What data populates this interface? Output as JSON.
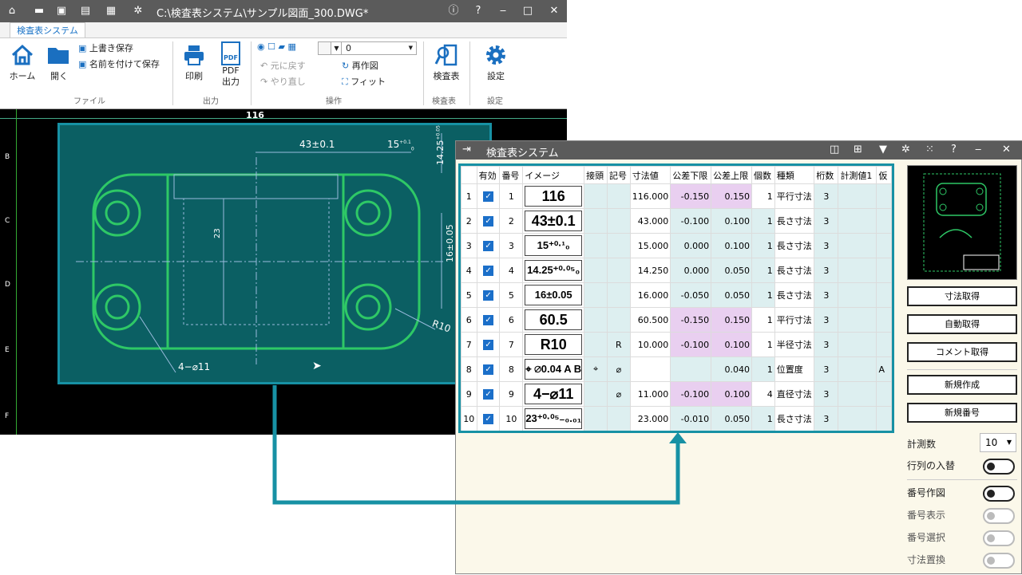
{
  "app": {
    "title": "C:\\検査表システム\\サンプル図面_300.DWG*",
    "tab": "検査表システム",
    "ribbon": {
      "home": "ホーム",
      "open": "開く",
      "save": "上書き保存",
      "save_as": "名前を付けて保存",
      "print": "印刷",
      "pdf_icon": "PDF",
      "pdf_out": "PDF出力",
      "layer_value": "0",
      "undo": "元に戻す",
      "redo": "やり直し",
      "redraw": "再作図",
      "fit": "フィット",
      "inspect": "検査表",
      "settings": "設定",
      "groups": {
        "file": "ファイル",
        "output": "出力",
        "operate": "操作",
        "inspect": "検査表",
        "settings": "設定"
      }
    }
  },
  "drawing": {
    "dims": {
      "top": "116",
      "d43": "43±0.1",
      "d15": "15",
      "d15tol": "+0.1",
      "d15tol2": "0",
      "d14": "14.25",
      "d14tol": "+0.05",
      "d23": "23",
      "d16": "16±0.05",
      "r10": "R10",
      "hole": "4−⌀11"
    },
    "ruler": [
      "B",
      "C",
      "D",
      "E",
      "F"
    ]
  },
  "inspector": {
    "title": "検査表システム",
    "columns": [
      "有効",
      "番号",
      "イメージ",
      "接頭",
      "記号",
      "寸法値",
      "公差下限",
      "公差上限",
      "個数",
      "種類",
      "桁数",
      "計測値1",
      "仮"
    ],
    "rows": [
      {
        "idx": "1",
        "num": "1",
        "img": "116",
        "prefix": "",
        "sym": "",
        "val": "116.000",
        "low": "-0.150",
        "up": "0.150",
        "qty": "1",
        "kind": "平行寸法",
        "digits": "3",
        "m1": "",
        "ex": ""
      },
      {
        "idx": "2",
        "num": "2",
        "img": "43±0.1",
        "prefix": "",
        "sym": "",
        "val": "43.000",
        "low": "-0.100",
        "up": "0.100",
        "qty": "1",
        "kind": "長さ寸法",
        "digits": "3",
        "m1": "",
        "ex": ""
      },
      {
        "idx": "3",
        "num": "3",
        "img": "15⁺⁰·¹₀",
        "prefix": "",
        "sym": "",
        "val": "15.000",
        "low": "0.000",
        "up": "0.100",
        "qty": "1",
        "kind": "長さ寸法",
        "digits": "3",
        "m1": "",
        "ex": ""
      },
      {
        "idx": "4",
        "num": "4",
        "img": "14.25⁺⁰·⁰⁵₀",
        "prefix": "",
        "sym": "",
        "val": "14.250",
        "low": "0.000",
        "up": "0.050",
        "qty": "1",
        "kind": "長さ寸法",
        "digits": "3",
        "m1": "",
        "ex": ""
      },
      {
        "idx": "5",
        "num": "5",
        "img": "16±0.05",
        "prefix": "",
        "sym": "",
        "val": "16.000",
        "low": "-0.050",
        "up": "0.050",
        "qty": "1",
        "kind": "長さ寸法",
        "digits": "3",
        "m1": "",
        "ex": ""
      },
      {
        "idx": "6",
        "num": "6",
        "img": "60.5",
        "prefix": "",
        "sym": "",
        "val": "60.500",
        "low": "-0.150",
        "up": "0.150",
        "qty": "1",
        "kind": "平行寸法",
        "digits": "3",
        "m1": "",
        "ex": ""
      },
      {
        "idx": "7",
        "num": "7",
        "img": "R10",
        "prefix": "",
        "sym": "R",
        "val": "10.000",
        "low": "-0.100",
        "up": "0.100",
        "qty": "1",
        "kind": "半径寸法",
        "digits": "3",
        "m1": "",
        "ex": ""
      },
      {
        "idx": "8",
        "num": "8",
        "img": "⌖ ⌀0.04 A B",
        "prefix": "⌖",
        "sym": "⌀",
        "val": "",
        "low": "",
        "up": "0.040",
        "qty": "1",
        "kind": "位置度",
        "digits": "3",
        "m1": "",
        "ex": "A"
      },
      {
        "idx": "9",
        "num": "9",
        "img": "4−⌀11",
        "prefix": "",
        "sym": "⌀",
        "val": "11.000",
        "low": "-0.100",
        "up": "0.100",
        "qty": "4",
        "kind": "直径寸法",
        "digits": "3",
        "m1": "",
        "ex": ""
      },
      {
        "idx": "10",
        "num": "10",
        "img": "23⁺⁰·⁰⁵₋₀.₀₁",
        "prefix": "",
        "sym": "",
        "val": "23.000",
        "low": "-0.010",
        "up": "0.050",
        "qty": "1",
        "kind": "長さ寸法",
        "digits": "3",
        "m1": "",
        "ex": ""
      }
    ],
    "buttons": {
      "get_dim": "寸法取得",
      "auto_get": "自動取得",
      "get_comment": "コメント取得",
      "new_create": "新規作成",
      "new_number": "新規番号"
    },
    "measure_label": "計測数",
    "measure_value": "10",
    "toggles": {
      "swap": "行列の入替",
      "num_draw": "番号作図",
      "num_show": "番号表示",
      "num_select": "番号選択",
      "dim_replace": "寸法置換"
    }
  }
}
